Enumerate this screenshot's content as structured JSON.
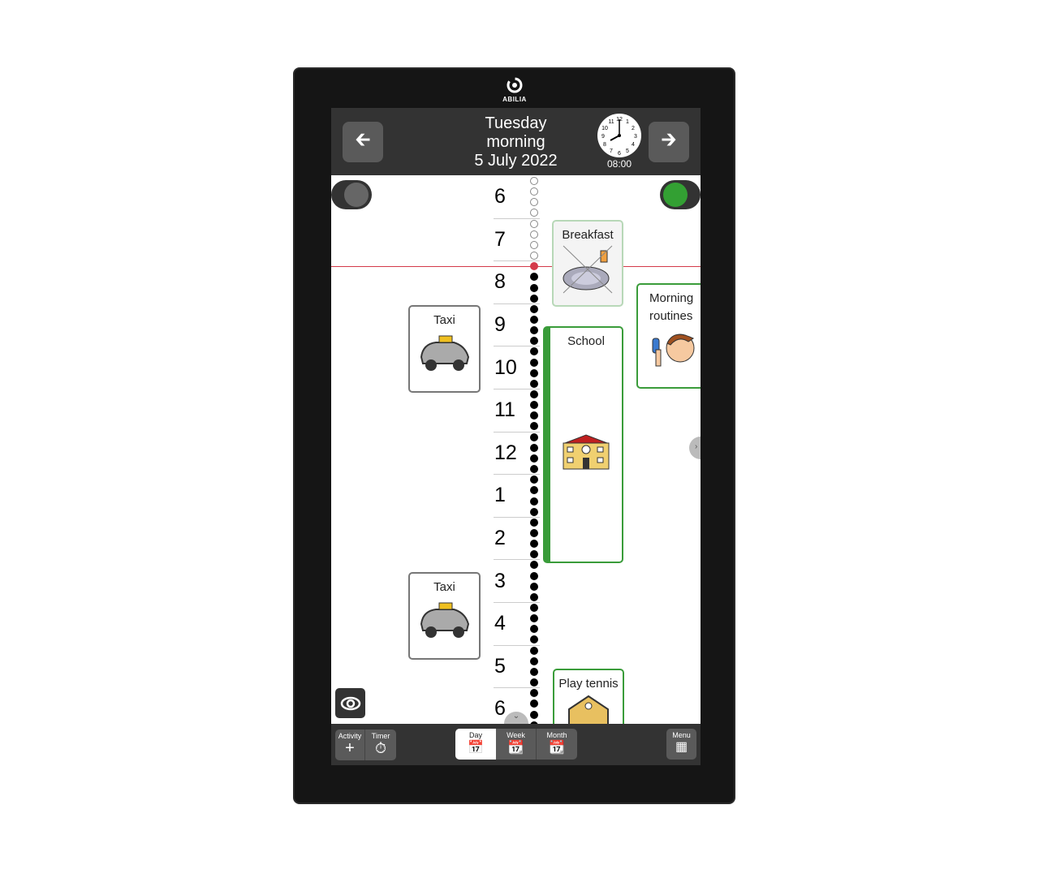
{
  "brand": "ABILIA",
  "header": {
    "day": "Tuesday",
    "period": "morning",
    "date": "5 July 2022",
    "clock_time": "08:00",
    "prev_icon": "arrow-left-icon",
    "next_icon": "arrow-right-icon"
  },
  "timeline": {
    "hours": [
      "6",
      "7",
      "8",
      "9",
      "10",
      "11",
      "12",
      "1",
      "2",
      "3",
      "4",
      "5",
      "6"
    ],
    "current_time": "08:00",
    "now_color": "#d43a4a"
  },
  "activities": {
    "breakfast": {
      "title": "Breakfast",
      "icon": "breakfast-plate-icon"
    },
    "morning_routines": {
      "title": "Morning routines",
      "icon": "hair-brushing-icon"
    },
    "school": {
      "title": "School",
      "icon": "school-building-icon"
    },
    "taxi_morning": {
      "title": "Taxi",
      "icon": "taxi-icon"
    },
    "taxi_afternoon": {
      "title": "Taxi",
      "icon": "taxi-icon"
    },
    "play_tennis": {
      "title": "Play tennis",
      "icon": "tennis-club-icon"
    }
  },
  "bottom_bar": {
    "activity": "Activity",
    "timer": "Timer",
    "day": "Day",
    "week": "Week",
    "month": "Month",
    "menu": "Menu",
    "active_tab": "Day"
  },
  "colors": {
    "accent_green": "#3a9c3a",
    "header_bg": "#333333"
  }
}
